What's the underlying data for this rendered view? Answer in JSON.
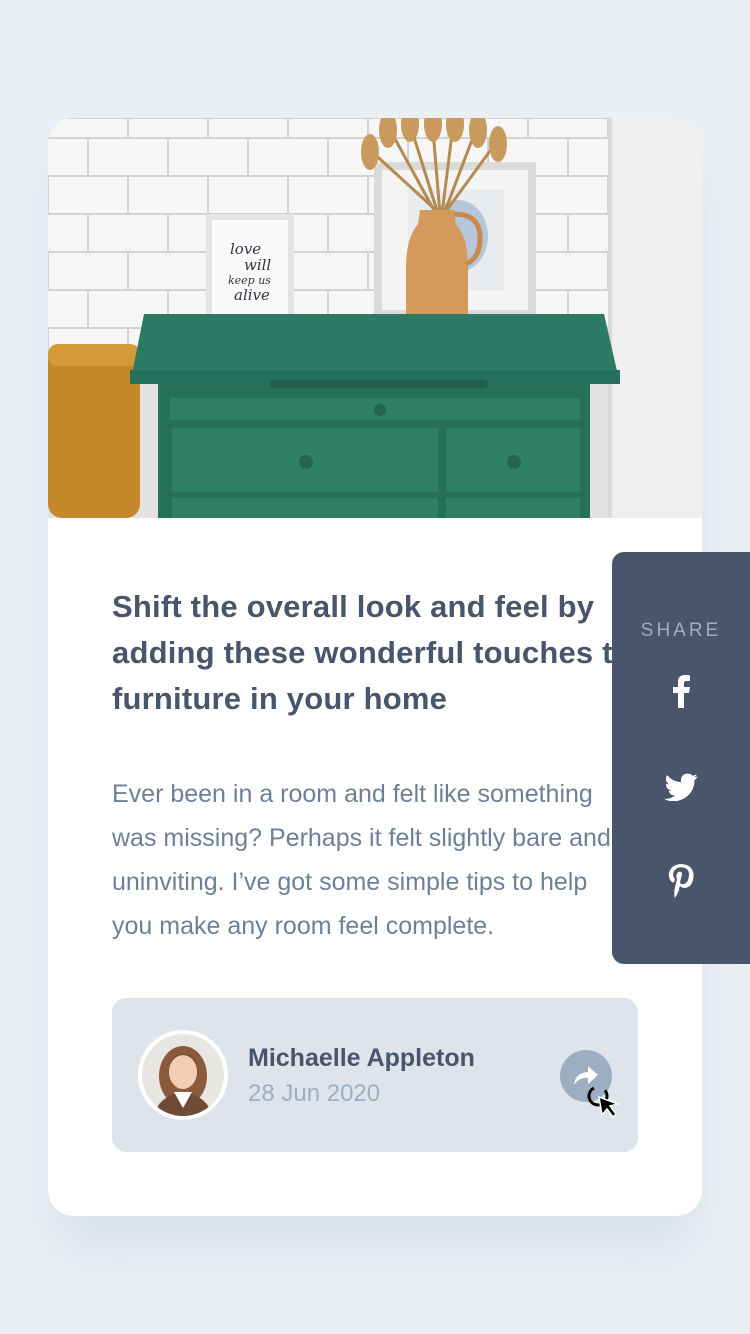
{
  "article": {
    "title": "Shift the overall look and feel by adding these wonderful touches to furniture in your home",
    "description": "Ever been in a room and felt like something was missing? Perhaps it felt slightly bare and uninviting. I’ve got some simple tips to help you make any room feel complete."
  },
  "author": {
    "name": "Michaelle Appleton",
    "date": "28 Jun 2020"
  },
  "share": {
    "label": "SHARE",
    "icons": [
      "facebook-icon",
      "twitter-icon",
      "pinterest-icon",
      "share-arrow-icon"
    ]
  },
  "poster_text": {
    "line1": "love",
    "line2": "will",
    "line3": "keep us",
    "line4": "alive"
  },
  "colors": {
    "page_bg": "#EBEFF3",
    "card_bg": "#FFFFFF",
    "title": "#48556A",
    "text": "#6E8098",
    "muted": "#9DAEC2",
    "author_bg": "#DFE4EC",
    "panel_bg": "#48556A"
  }
}
